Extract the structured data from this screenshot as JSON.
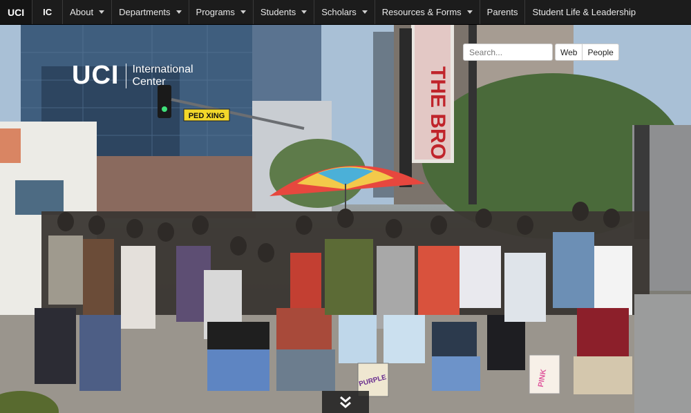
{
  "nav": {
    "brand": "UCI",
    "ic": "IC",
    "items": [
      {
        "label": "About",
        "dropdown": true
      },
      {
        "label": "Departments",
        "dropdown": true
      },
      {
        "label": "Programs",
        "dropdown": true
      },
      {
        "label": "Students",
        "dropdown": true
      },
      {
        "label": "Scholars",
        "dropdown": true
      },
      {
        "label": "Resources & Forms",
        "dropdown": true
      },
      {
        "label": "Parents",
        "dropdown": false
      },
      {
        "label": "Student Life & Leadership",
        "dropdown": false
      }
    ]
  },
  "logo": {
    "mark": "UCI",
    "line1": "International",
    "line2": "Center"
  },
  "search": {
    "placeholder": "Search...",
    "web_label": "Web",
    "people_label": "People"
  },
  "hero": {
    "street_sign": "PED XING",
    "banner_word": "THE BRO",
    "bag_left": "PURPLE",
    "bag_right": "PINK"
  },
  "colors": {
    "nav_bg": "#1c1c1c",
    "banner_red": "#c0242b",
    "sign_yellow": "#f2d72a"
  }
}
